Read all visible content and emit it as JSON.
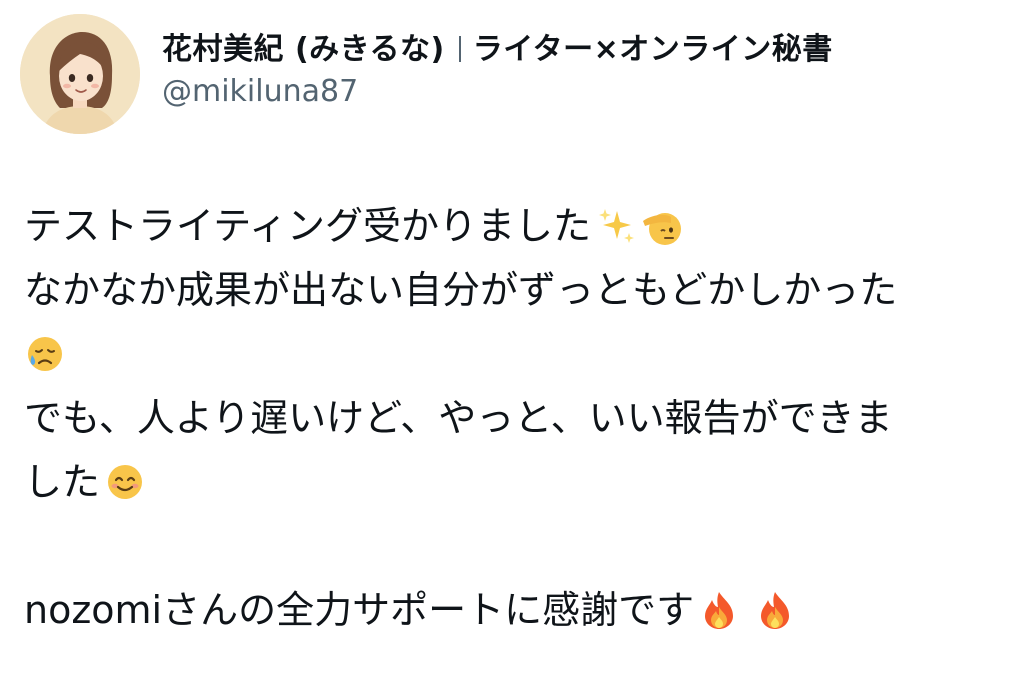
{
  "author": {
    "display_name": "花村美紀 (みきるな)",
    "tagline": "ライター×オンライン秘書",
    "handle": "@mikiluna87",
    "avatar": "illustrated-woman-avatar"
  },
  "tweet": {
    "line1": "テストライティング受かりました",
    "line1_emojis": [
      "sparkles-emoji",
      "saluting-hand-face-emoji"
    ],
    "line2": "なかなか成果が出ない自分がずっともどかしかった",
    "line3_emoji": "sad-relieved-face-emoji",
    "line4": "でも、人より遅いけど、やっと、いい報告ができま",
    "line5": "した",
    "line5_emoji": "smiling-face-emoji",
    "line6": "nozomiさんの全力サポートに感謝です",
    "line6_emojis": [
      "fire-emoji",
      "fire-emoji"
    ]
  }
}
